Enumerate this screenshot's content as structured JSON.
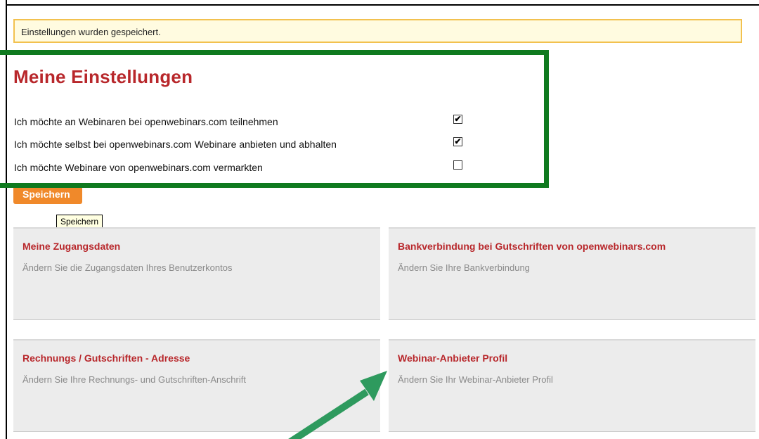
{
  "notice": {
    "text": "Einstellungen wurden gespeichert."
  },
  "settings": {
    "title": "Meine Einstellungen",
    "options": [
      {
        "label": "Ich möchte an Webinaren bei openwebinars.com teilnehmen",
        "checked": true
      },
      {
        "label": "Ich möchte selbst bei openwebinars.com Webinare anbieten und abhalten",
        "checked": true
      },
      {
        "label": "Ich möchte Webinare von openwebinars.com vermarkten",
        "checked": false
      }
    ],
    "save_label": "Speichern",
    "tooltip": "Speichern"
  },
  "panels": [
    {
      "title": "Meine Zugangsdaten",
      "desc": "Ändern Sie die Zugangsdaten Ihres Benutzerkontos"
    },
    {
      "title": "Bankverbindung bei Gutschriften von openwebinars.com",
      "desc": "Ändern Sie Ihre Bankverbindung"
    },
    {
      "title": "Rechnungs / Gutschriften - Adresse",
      "desc": "Ändern Sie Ihre Rechnungs- und Gutschriften-Anschrift"
    },
    {
      "title": "Webinar-Anbieter Profil",
      "desc": "Ändern Sie Ihr Webinar-Anbieter Profil"
    }
  ],
  "annotations": {
    "highlight_color": "#0f7a1f",
    "arrow_color": "#2e9a5e"
  }
}
